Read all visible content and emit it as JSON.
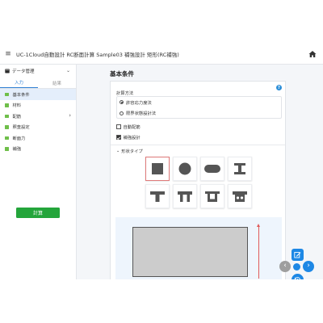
{
  "header": {
    "title": "UC-1Cloud自動設計 RC断面計算  Sample03 補強設計 矩形(RC補強)"
  },
  "sidebar": {
    "data_menu_label": "データ管理",
    "tabs": [
      {
        "label": "入力",
        "active": true
      },
      {
        "label": "結果",
        "active": false
      }
    ],
    "items": [
      {
        "label": "基本条件",
        "active": true
      },
      {
        "label": "材料"
      },
      {
        "label": "配筋"
      },
      {
        "label": "照査設定"
      },
      {
        "label": "断面力"
      },
      {
        "label": "補強"
      }
    ],
    "calc_button": "計算"
  },
  "main": {
    "title": "基本条件",
    "calc_method_label": "計算方法",
    "calc_methods": [
      {
        "label": "許容応力度法",
        "selected": true
      },
      {
        "label": "限界状態設計法",
        "selected": false
      }
    ],
    "checkboxes": [
      {
        "label": "自動配筋",
        "checked": false
      },
      {
        "label": "補強設計",
        "checked": true
      }
    ],
    "shape_type_label": "形状タイプ",
    "selected_shape_index": 0
  },
  "colors": {
    "accent_blue": "#2d7fd3",
    "green_button": "#24a53b",
    "sidebar_marker": "#6fbf4a",
    "fab_blue": "#1e88e5",
    "fab_gray": "#9e9e9e"
  },
  "icons": [
    "menu-icon",
    "home-icon",
    "database-icon",
    "chevron-down-icon",
    "chevron-right-icon",
    "help-icon",
    "edit-icon",
    "history-icon",
    "arrow-left-icon",
    "arrow-right-icon"
  ]
}
